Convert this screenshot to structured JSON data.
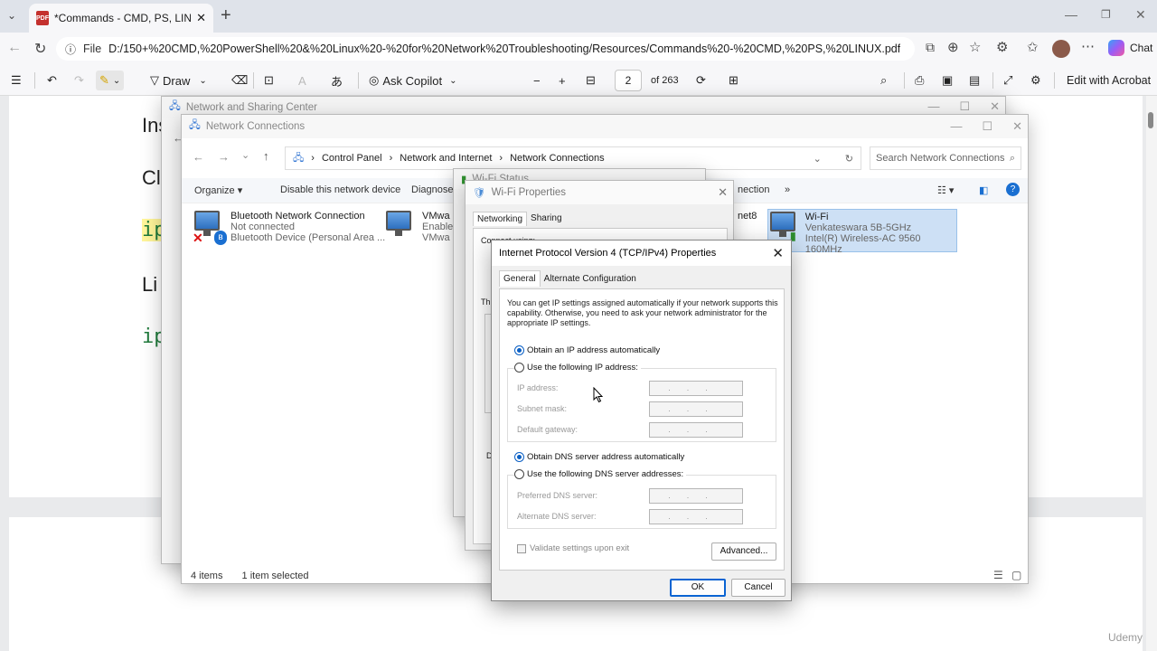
{
  "browser": {
    "tab_title": "*Commands - CMD, PS, LINUX.pdf",
    "file_label": "File",
    "url": "D:/150+%20CMD,%20PowerShell%20&%20Linux%20-%20for%20Network%20Troubleshooting/Resources/Commands%20-%20CMD,%20PS,%20LINUX.pdf",
    "chat_label": "Chat"
  },
  "pdf_toolbar": {
    "draw_label": "Draw",
    "copilot_label": "Ask Copilot",
    "page_number": "2",
    "page_total": "of 263",
    "edit_label": "Edit with Acrobat"
  },
  "pdf_page": {
    "line1": "Ins",
    "line2": "Cl",
    "code1": "ip",
    "line3": "Li",
    "code2": "ip"
  },
  "nsc_window": {
    "title": "Network and Sharing Center"
  },
  "nc_window": {
    "title": "Network Connections",
    "breadcrumb": [
      "Control Panel",
      "Network and Internet",
      "Network Connections"
    ],
    "search_placeholder": "Search Network Connections",
    "commands": {
      "organize": "Organize ▾",
      "disable": "Disable this network device",
      "diagnose": "Diagnose t",
      "connection": "nection",
      "more": "»"
    },
    "connections": [
      {
        "name": "Bluetooth Network Connection",
        "status": "Not connected",
        "device": "Bluetooth Device (Personal Area ..."
      },
      {
        "name": "VMwa",
        "status": "Enable",
        "device": "VMwa"
      },
      {
        "name": "net8",
        "status": "",
        "device": ""
      },
      {
        "name": "Wi-Fi",
        "status": "Venkateswara 5B-5GHz",
        "device": "Intel(R) Wireless-AC 9560 160MHz"
      }
    ],
    "status_items": "4 items",
    "status_selected": "1 item selected"
  },
  "wifi_status": {
    "title": "Wi-Fi Status"
  },
  "wifi_props": {
    "title": "Wi-Fi Properties",
    "tabs": [
      "Networking",
      "Sharing"
    ],
    "conn_label": "Connect using:",
    "this_label": "Th",
    "d_label": "D"
  },
  "ipv4": {
    "title": "Internet Protocol Version 4 (TCP/IPv4) Properties",
    "tabs": [
      "General",
      "Alternate Configuration"
    ],
    "intro": "You can get IP settings assigned automatically if your network supports this capability. Otherwise, you need to ask your network administrator for the appropriate IP settings.",
    "obtain_ip": "Obtain an IP address automatically",
    "use_ip": "Use the following IP address:",
    "ip_label": "IP address:",
    "subnet_label": "Subnet mask:",
    "gateway_label": "Default gateway:",
    "obtain_dns": "Obtain DNS server address automatically",
    "use_dns": "Use the following DNS server addresses:",
    "pref_dns_label": "Preferred DNS server:",
    "alt_dns_label": "Alternate DNS server:",
    "dots": "...",
    "validate_label": "Validate settings upon exit",
    "advanced_label": "Advanced...",
    "ok_label": "OK",
    "cancel_label": "Cancel"
  },
  "watermark": "Udemy"
}
